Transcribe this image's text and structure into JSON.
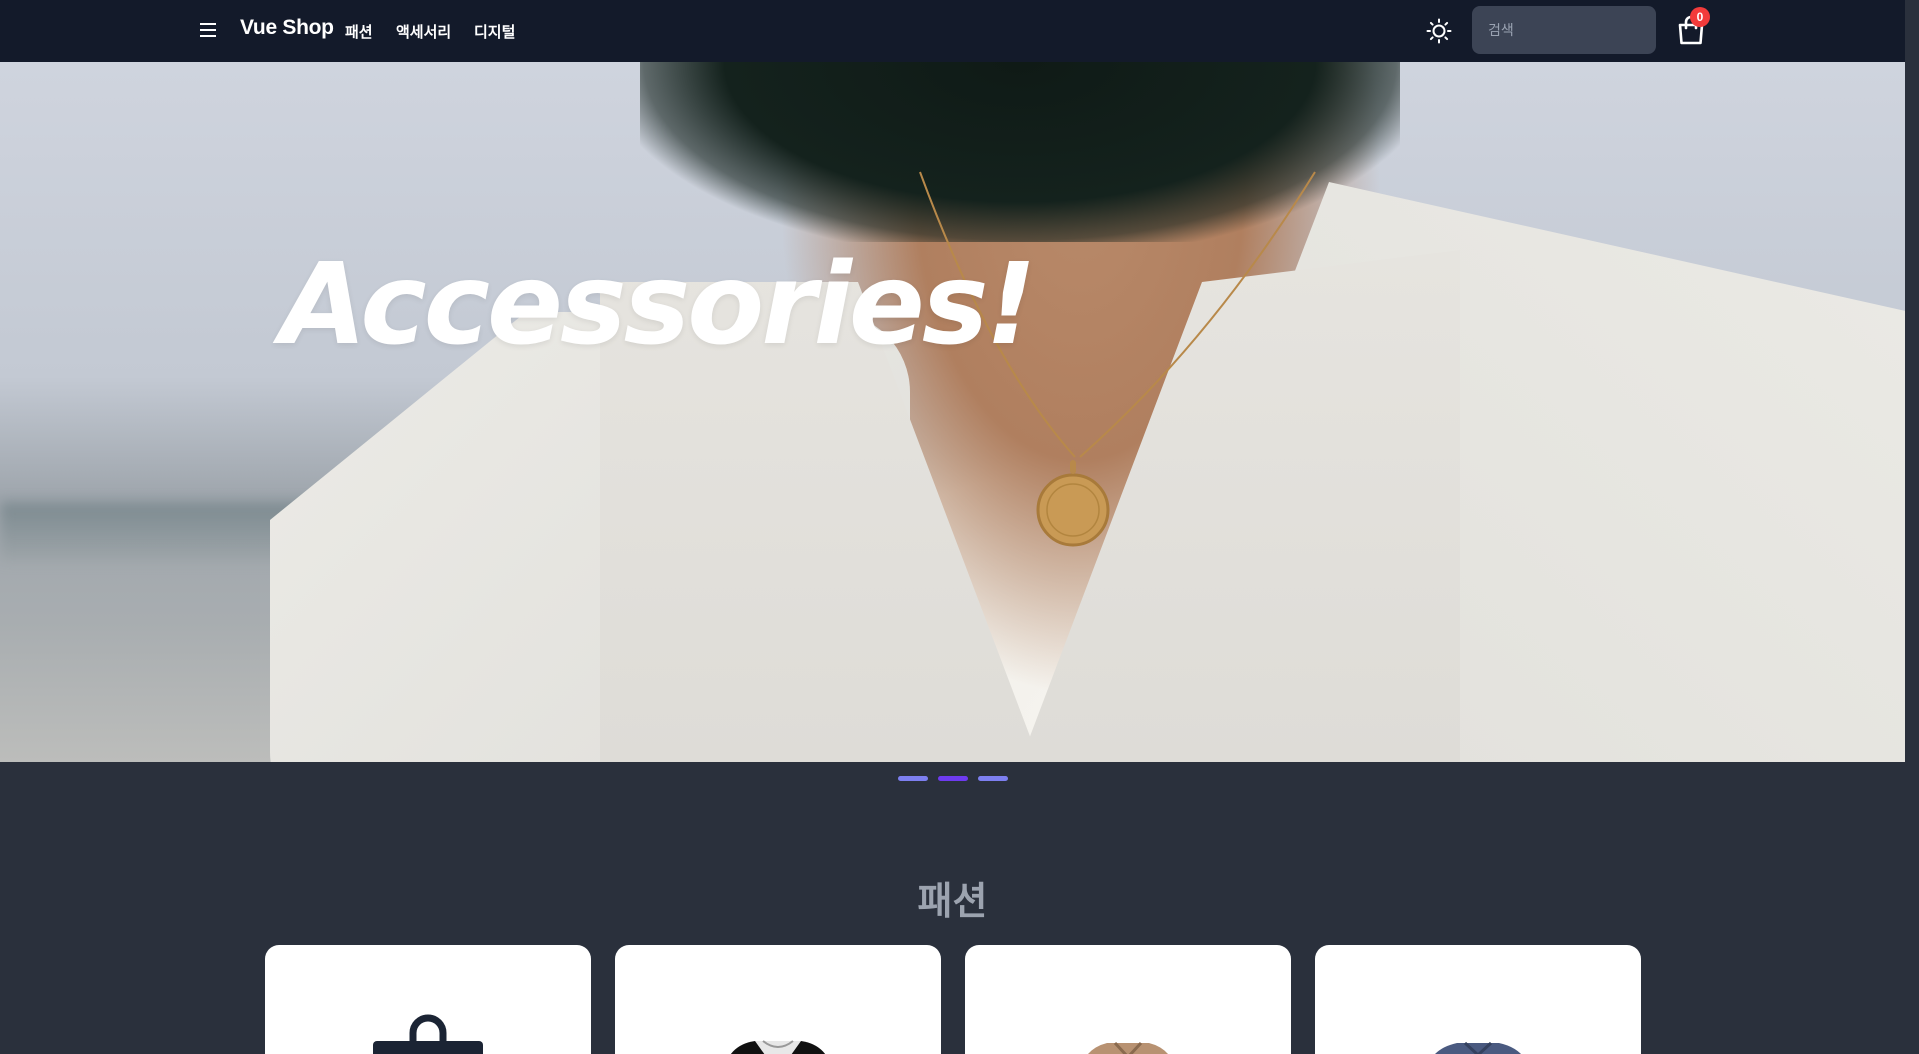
{
  "navbar": {
    "brand": "Vue Shop",
    "links": [
      "패션",
      "액세서리",
      "디지털"
    ],
    "search_placeholder": "검색",
    "cart_count": "0",
    "menu_icon": "hamburger-menu-icon",
    "theme_icon": "sun-icon",
    "cart_icon": "shopping-bag-icon"
  },
  "hero": {
    "title": "Accessories!",
    "slides": 3,
    "active_slide": 2
  },
  "section": {
    "title": "패션",
    "products": [
      {
        "name": "product-bag"
      },
      {
        "name": "product-raglan-shirt"
      },
      {
        "name": "product-jacket"
      },
      {
        "name": "product-tshirt"
      }
    ]
  },
  "colors": {
    "navbar_bg": "#131a2a",
    "page_bg": "#2a303c",
    "accent": "#6e3bf0",
    "badge": "#f23b3b"
  }
}
